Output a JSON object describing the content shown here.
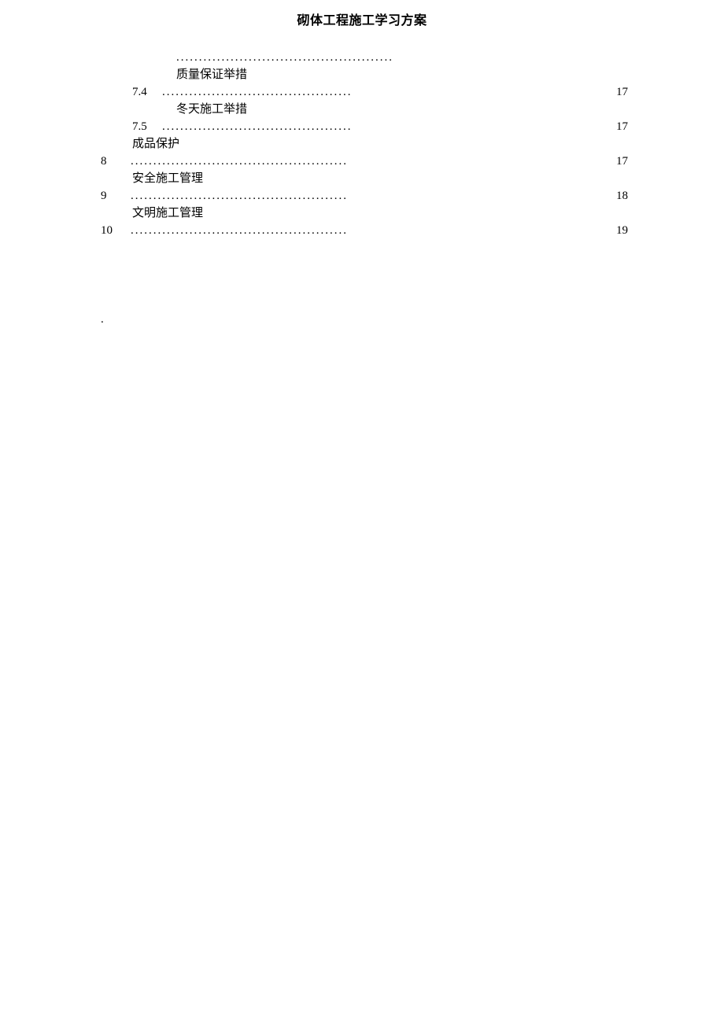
{
  "header": {
    "title": "砌体工程施工学习方案"
  },
  "toc": {
    "leader": "................................................",
    "leader_short": "..........................................",
    "rows": [
      {
        "type": "dots_only_indent"
      },
      {
        "type": "label_indent",
        "text": "质量保证举措"
      },
      {
        "type": "sub",
        "num": "7.4",
        "page": "17"
      },
      {
        "type": "label_indent",
        "text": "冬天施工举措"
      },
      {
        "type": "sub",
        "num": "7.5",
        "page": "17"
      },
      {
        "type": "label_small",
        "text": "成品保护"
      },
      {
        "type": "top",
        "num": "8",
        "page": "17"
      },
      {
        "type": "label_small",
        "text": "安全施工管理"
      },
      {
        "type": "top",
        "num": "9",
        "page": "18"
      },
      {
        "type": "label_small",
        "text": "文明施工管理"
      },
      {
        "type": "top",
        "num": "10",
        "page": "19"
      }
    ]
  },
  "misc": {
    "lone_dot": "."
  }
}
